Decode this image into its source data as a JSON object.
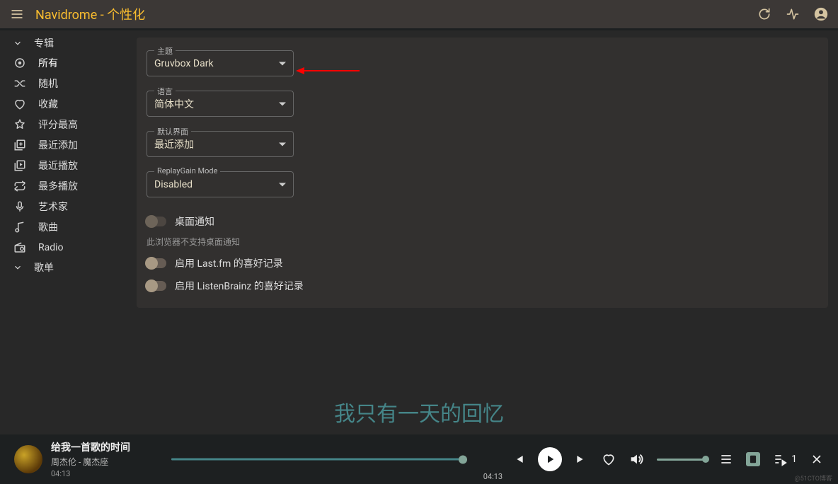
{
  "appbar": {
    "title": "Navidrome - 个性化"
  },
  "sidebar": {
    "albums": {
      "label": "专辑",
      "items": [
        {
          "icon": "dot",
          "label": "所有",
          "active": true
        },
        {
          "icon": "shuffle",
          "label": "随机"
        },
        {
          "icon": "heart",
          "label": "收藏"
        },
        {
          "icon": "star",
          "label": "评分最高"
        },
        {
          "icon": "recent-add",
          "label": "最近添加"
        },
        {
          "icon": "recent-play",
          "label": "最近播放"
        },
        {
          "icon": "most-play",
          "label": "最多播放"
        }
      ]
    },
    "artists": {
      "icon": "mic",
      "label": "艺术家"
    },
    "songs": {
      "icon": "note",
      "label": "歌曲"
    },
    "radio": {
      "icon": "radio",
      "label": "Radio"
    },
    "playlists": {
      "label": "歌单"
    }
  },
  "settings": {
    "theme": {
      "label": "主题",
      "value": "Gruvbox Dark"
    },
    "language": {
      "label": "语言",
      "value": "简体中文"
    },
    "default_view": {
      "label": "默认界面",
      "value": "最近添加"
    },
    "replaygain": {
      "label": "ReplayGain Mode",
      "value": "Disabled"
    },
    "desktop_notify": {
      "label": "桌面通知",
      "helper": "此浏览器不支持桌面通知"
    },
    "lastfm": {
      "label": "启用 Last.fm 的喜好记录"
    },
    "listenbrainz": {
      "label": "启用 ListenBrainz 的喜好记录"
    }
  },
  "lyric": "我只有一天的回忆",
  "player": {
    "title": "给我一首歌的时间",
    "artist": "周杰伦 - 魔杰座",
    "elapsed": "04:13",
    "duration": "04:13",
    "queue_count": "1"
  },
  "watermark": "@51CTO博客"
}
